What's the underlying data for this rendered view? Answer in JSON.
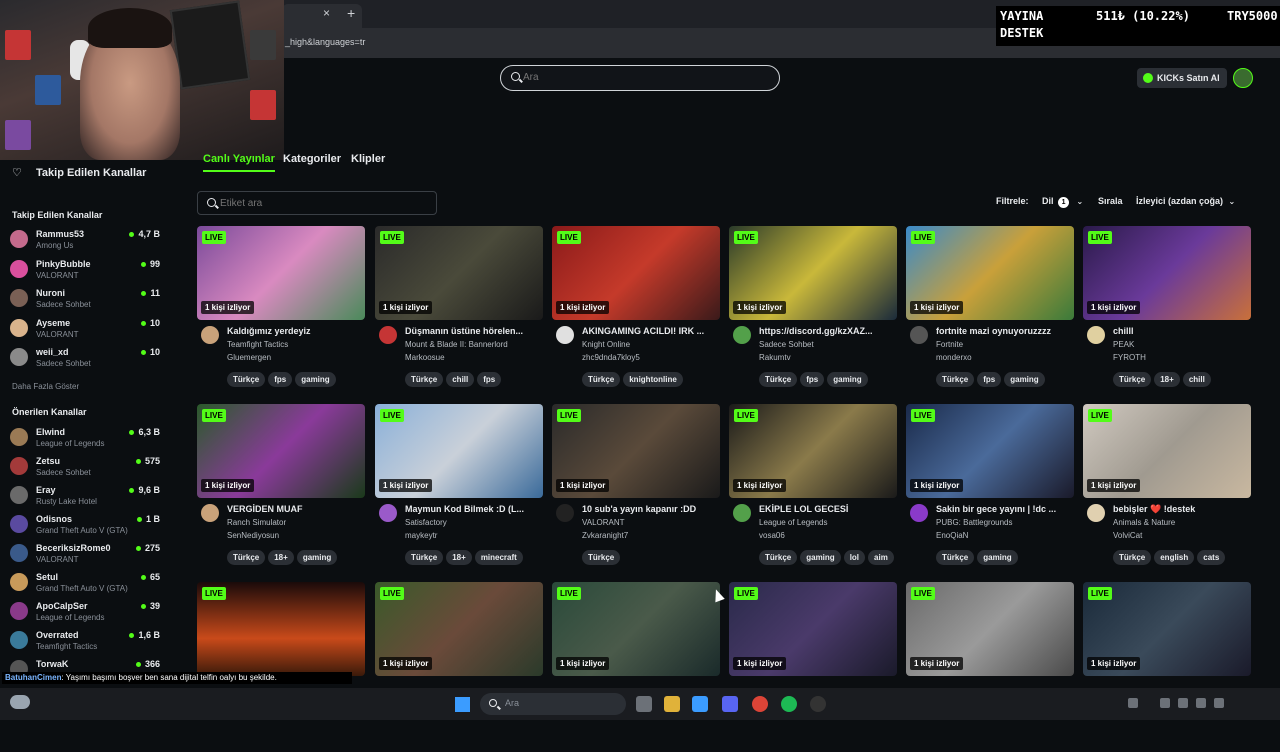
{
  "browser": {
    "tab_close": "×",
    "new_tab": "+",
    "url": "_high&languages=tr"
  },
  "header": {
    "search_placeholder": "Ara",
    "kicks_button": "KICKs Satın Al"
  },
  "donation": {
    "label1": "YAYINA",
    "amount": "511₺ (10.22%)",
    "target": "TRY5000",
    "label2": "DESTEK"
  },
  "sidebar": {
    "header": "Takip Edilen Kanallar",
    "followed_title": "Takip Edilen Kanallar",
    "followed": [
      {
        "name": "Rammus53",
        "game": "Among Us",
        "viewers": "4,7 B",
        "color": "#c46a8c"
      },
      {
        "name": "PinkyBubble",
        "game": "VALORANT",
        "viewers": "99",
        "color": "#d94f9d"
      },
      {
        "name": "Nuroni",
        "game": "Sadece Sohbet",
        "viewers": "11",
        "color": "#7a6055"
      },
      {
        "name": "Ayseme",
        "game": "VALORANT",
        "viewers": "10",
        "color": "#d9b38c"
      },
      {
        "name": "weii_xd",
        "game": "Sadece Sohbet",
        "viewers": "10",
        "color": "#8a8a8a"
      }
    ],
    "show_more": "Daha Fazla Göster",
    "recommended_title": "Önerilen Kanallar",
    "recommended": [
      {
        "name": "Elwind",
        "game": "League of Legends",
        "viewers": "6,3 B",
        "color": "#9a7a55"
      },
      {
        "name": "Zetsu",
        "game": "Sadece Sohbet",
        "viewers": "575",
        "color": "#a33a3a"
      },
      {
        "name": "Eray",
        "game": "Rusty Lake Hotel",
        "viewers": "9,6 B",
        "color": "#6a6a6a"
      },
      {
        "name": "Odisnos",
        "game": "Grand Theft Auto V (GTA)",
        "viewers": "1 B",
        "color": "#5a4aa0"
      },
      {
        "name": "BeceriksizRome0",
        "game": "VALORANT",
        "viewers": "275",
        "color": "#3a5a8a"
      },
      {
        "name": "Setul",
        "game": "Grand Theft Auto V (GTA)",
        "viewers": "65",
        "color": "#c89a5a"
      },
      {
        "name": "ApoCalpSer",
        "game": "League of Legends",
        "viewers": "39",
        "color": "#8a3a8a"
      },
      {
        "name": "Overrated",
        "game": "Teamfight Tactics",
        "viewers": "1,6 B",
        "color": "#3a7a9a"
      },
      {
        "name": "TorwaK",
        "game": "",
        "viewers": "366",
        "color": "#555"
      }
    ]
  },
  "main": {
    "tabs": [
      "Canlı Yayınlar",
      "Kategoriler",
      "Klipler"
    ],
    "tag_search_placeholder": "Etiket ara",
    "filter_label": "Filtrele:",
    "language_label": "Dil",
    "language_count": "1",
    "sort_label": "Sırala",
    "sort_value": "İzleyici (azdan çoğa)",
    "live_label": "LIVE",
    "cards": [
      {
        "viewers": "1 kişi izliyor",
        "title": "Kaldığımız yerdeyiz",
        "game": "Teamfight Tactics",
        "streamer": "Gluemergen",
        "tags": [
          "Türkçe",
          "fps",
          "gaming"
        ],
        "thumb": "linear-gradient(135deg,#7a4a9a,#d98ac0 50%,#4a8a5a)",
        "avatar": "#c9a27a"
      },
      {
        "viewers": "1 kişi izliyor",
        "title": "Düşmanın üstüne hörelen...",
        "game": "Mount & Blade II: Bannerlord",
        "streamer": "Markoosue",
        "tags": [
          "Türkçe",
          "chill",
          "fps"
        ],
        "thumb": "linear-gradient(135deg,#2a2a2a,#4a4a3a 50%,#1a1a1a)",
        "avatar": "#c53535"
      },
      {
        "viewers": "1 kişi izliyor",
        "title": "AKINGAMING ACILDI! IRK ...",
        "game": "Knight Online",
        "streamer": "zhc9dnda7kloy5",
        "tags": [
          "Türkçe",
          "knightonline"
        ],
        "thumb": "linear-gradient(135deg,#8a1a1a,#c53a2a 50%,#3a1a1a)",
        "avatar": "#e0e0e0"
      },
      {
        "viewers": "1 kişi izliyor",
        "title": "https://discord.gg/kzXAZ...",
        "game": "Sadece Sohbet",
        "streamer": "Rakumtv",
        "tags": [
          "Türkçe",
          "fps",
          "gaming"
        ],
        "thumb": "linear-gradient(135deg,#2a3a2a,#c9b83a 50%,#1a2a3a)",
        "avatar": "#53a04a"
      },
      {
        "viewers": "1 kişi izliyor",
        "title": "fortnite mazi oynuyoruzzzz",
        "game": "Fortnite",
        "streamer": "monderxo",
        "tags": [
          "Türkçe",
          "fps",
          "gaming"
        ],
        "thumb": "linear-gradient(135deg,#3a8ac9,#c9a03a 50%,#3a7a3a)",
        "avatar": "#555"
      },
      {
        "viewers": "1 kişi izliyor",
        "title": "chilll",
        "game": "PEAK",
        "streamer": "FYROTH",
        "tags": [
          "Türkçe",
          "18+",
          "chill"
        ],
        "thumb": "linear-gradient(135deg,#2a1a4a,#6a3a9a 50%,#c9703a)",
        "avatar": "#e0d0a0"
      },
      {
        "viewers": "1 kişi izliyor",
        "title": "VERGİDEN MUAF",
        "game": "Ranch Simulator",
        "streamer": "SenNediyosun",
        "tags": [
          "Türkçe",
          "18+",
          "gaming"
        ],
        "thumb": "linear-gradient(135deg,#2a5a2a,#8a3a9a 50%,#1a3a1a)",
        "avatar": "#c9a27a"
      },
      {
        "viewers": "1 kişi izliyor",
        "title": "Maymun Kod Bilmek :D (L...",
        "game": "Satisfactory",
        "streamer": "maykeytr",
        "tags": [
          "Türkçe",
          "18+",
          "minecraft"
        ],
        "thumb": "linear-gradient(135deg,#8ab0d9,#c9d0d9 50%,#3a6a9a)",
        "avatar": "#9a5ac9"
      },
      {
        "viewers": "1 kişi izliyor",
        "title": "10 sub'a yayın kapanır :DD",
        "game": "VALORANT",
        "streamer": "Zvkaranight7",
        "tags": [
          "Türkçe"
        ],
        "thumb": "linear-gradient(135deg,#2a2a2a,#5a4a3a 50%,#1a1a1a)",
        "avatar": "#222"
      },
      {
        "viewers": "1 kişi izliyor",
        "title": "EKİPLE LOL GECESİ",
        "game": "League of Legends",
        "streamer": "vosa06",
        "tags": [
          "Türkçe",
          "gaming",
          "lol",
          "aim"
        ],
        "thumb": "linear-gradient(135deg,#1a1a1a,#8a7a4a 50%,#1a1a1a)",
        "avatar": "#53a04a"
      },
      {
        "viewers": "1 kişi izliyor",
        "title": "Sakin bir gece yayını | !dc ...",
        "game": "PUBG: Battlegrounds",
        "streamer": "EnoQiaN",
        "tags": [
          "Türkçe",
          "gaming"
        ],
        "thumb": "linear-gradient(135deg,#1a2a4a,#4a6a9a 50%,#1a1a2a)",
        "avatar": "#8a3ac9"
      },
      {
        "viewers": "1 kişi izliyor",
        "title": "bebişler ❤️ !destek",
        "game": "Animals & Nature",
        "streamer": "VolviCat",
        "tags": [
          "Türkçe",
          "english",
          "cats"
        ],
        "thumb": "linear-gradient(135deg,#d0c9c0,#a09a90 50%,#c9b8a0)",
        "avatar": "#e0d0b0"
      },
      {
        "viewers": "",
        "title": "",
        "game": "",
        "streamer": "",
        "tags": [],
        "thumb": "linear-gradient(180deg,#1a0a0a,#c94a1a 60%,#3a1a0a)",
        "avatar": ""
      },
      {
        "viewers": "1 kişi izliyor",
        "title": "",
        "game": "",
        "streamer": "",
        "tags": [],
        "thumb": "linear-gradient(135deg,#3a5a2a,#6a4a3a 50%,#2a3a2a)",
        "avatar": ""
      },
      {
        "viewers": "1 kişi izliyor",
        "title": "",
        "game": "",
        "streamer": "",
        "tags": [],
        "thumb": "linear-gradient(135deg,#2a4a3a,#4a5a4a 50%,#1a2a2a)",
        "avatar": ""
      },
      {
        "viewers": "1 kişi izliyor",
        "title": "",
        "game": "",
        "streamer": "",
        "tags": [],
        "thumb": "linear-gradient(135deg,#2a2a4a,#4a3a6a 50%,#1a1a2a)",
        "avatar": ""
      },
      {
        "viewers": "1 kişi izliyor",
        "title": "",
        "game": "",
        "streamer": "",
        "tags": [],
        "thumb": "linear-gradient(135deg,#6a6a6a,#9a9a9a 50%,#4a4a4a)",
        "avatar": ""
      },
      {
        "viewers": "1 kişi izliyor",
        "title": "",
        "game": "",
        "streamer": "",
        "tags": [],
        "thumb": "linear-gradient(135deg,#1a2a3a,#3a4a5a 50%,#1a1a2a)",
        "avatar": ""
      }
    ]
  },
  "chat": {
    "user": "BatuhanCimen",
    "message": ": Yaşımı başımı boşver ben sana dijital telfin oalyı bu şekilde."
  },
  "taskbar": {
    "search_placeholder": "Ara"
  }
}
